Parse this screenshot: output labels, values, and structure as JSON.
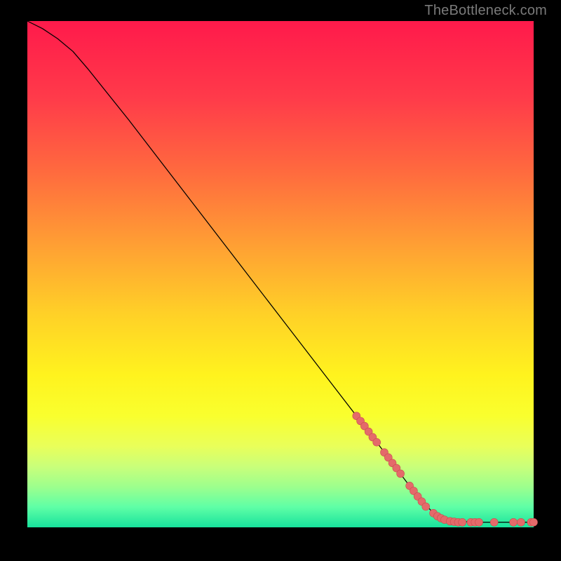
{
  "attribution": "TheBottleneck.com",
  "colors": {
    "curve": "#000000",
    "marker_fill": "#e46a6a",
    "marker_stroke": "#c94f4f",
    "frame_bg": "#000000",
    "gradient_top": "#ff1a4b",
    "gradient_bottom": "#17e29c"
  },
  "chart_data": {
    "type": "line",
    "title": "",
    "xlabel": "",
    "ylabel": "",
    "xlim": [
      0,
      100
    ],
    "ylim": [
      0,
      100
    ],
    "grid": false,
    "legend": false,
    "curve": [
      {
        "x": 0,
        "y": 100
      },
      {
        "x": 3,
        "y": 98.5
      },
      {
        "x": 6,
        "y": 96.5
      },
      {
        "x": 9,
        "y": 94
      },
      {
        "x": 12,
        "y": 90.5
      },
      {
        "x": 20,
        "y": 80.5
      },
      {
        "x": 30,
        "y": 67.5
      },
      {
        "x": 40,
        "y": 54.5
      },
      {
        "x": 50,
        "y": 41.5
      },
      {
        "x": 60,
        "y": 28.5
      },
      {
        "x": 70,
        "y": 15.5
      },
      {
        "x": 76,
        "y": 7.5
      },
      {
        "x": 80,
        "y": 3.0
      },
      {
        "x": 82,
        "y": 1.8
      },
      {
        "x": 84,
        "y": 1.2
      },
      {
        "x": 90,
        "y": 1.0
      },
      {
        "x": 100,
        "y": 1.0
      }
    ],
    "markers": [
      {
        "x": 65.0,
        "y": 22.0
      },
      {
        "x": 65.8,
        "y": 21.0
      },
      {
        "x": 66.6,
        "y": 20.0
      },
      {
        "x": 67.4,
        "y": 18.9
      },
      {
        "x": 68.2,
        "y": 17.8
      },
      {
        "x": 69.0,
        "y": 16.8
      },
      {
        "x": 70.5,
        "y": 14.8
      },
      {
        "x": 71.3,
        "y": 13.8
      },
      {
        "x": 72.1,
        "y": 12.7
      },
      {
        "x": 72.9,
        "y": 11.7
      },
      {
        "x": 73.7,
        "y": 10.6
      },
      {
        "x": 75.5,
        "y": 8.2
      },
      {
        "x": 76.3,
        "y": 7.2
      },
      {
        "x": 77.1,
        "y": 6.1
      },
      {
        "x": 77.9,
        "y": 5.1
      },
      {
        "x": 78.7,
        "y": 4.1
      },
      {
        "x": 80.2,
        "y": 2.8
      },
      {
        "x": 81.0,
        "y": 2.2
      },
      {
        "x": 81.7,
        "y": 1.8
      },
      {
        "x": 82.4,
        "y": 1.5
      },
      {
        "x": 83.5,
        "y": 1.2
      },
      {
        "x": 84.3,
        "y": 1.1
      },
      {
        "x": 85.1,
        "y": 1.0
      },
      {
        "x": 85.9,
        "y": 1.0
      },
      {
        "x": 87.6,
        "y": 1.0
      },
      {
        "x": 88.4,
        "y": 1.0
      },
      {
        "x": 89.2,
        "y": 1.0
      },
      {
        "x": 92.2,
        "y": 1.0
      },
      {
        "x": 96.0,
        "y": 1.0
      },
      {
        "x": 97.5,
        "y": 1.0
      },
      {
        "x": 99.5,
        "y": 1.0
      },
      {
        "x": 100.0,
        "y": 1.0
      }
    ],
    "marker_radius_px": 5.5
  }
}
